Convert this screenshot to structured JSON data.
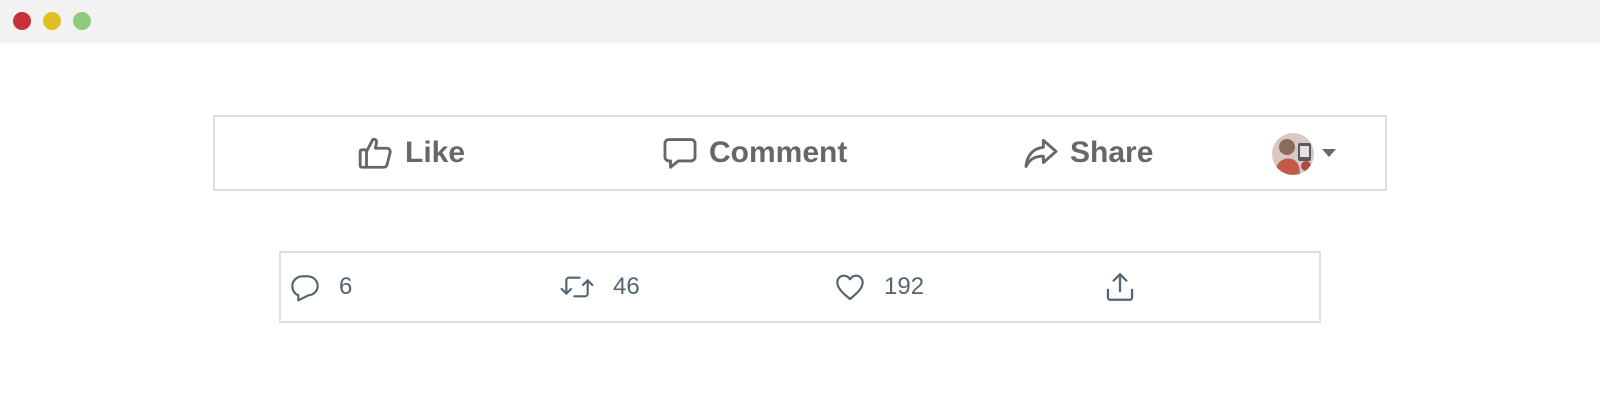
{
  "window": {
    "controls": [
      {
        "name": "close",
        "color": "#c7323a"
      },
      {
        "name": "minimize",
        "color": "#e2be26"
      },
      {
        "name": "zoom",
        "color": "#8ecb7c"
      }
    ]
  },
  "facebook_bar": {
    "like_label": "Like",
    "comment_label": "Comment",
    "share_label": "Share",
    "icons": [
      "thumbs-up-icon",
      "comment-bubble-icon",
      "share-arrow-icon",
      "avatar",
      "caret-down-icon"
    ],
    "text_color": "#65676b"
  },
  "twitter_bar": {
    "reply_count": "6",
    "retweet_count": "46",
    "like_count": "192",
    "icons": [
      "reply-icon",
      "retweet-icon",
      "heart-icon",
      "share-upload-icon"
    ],
    "text_color": "#536471"
  }
}
